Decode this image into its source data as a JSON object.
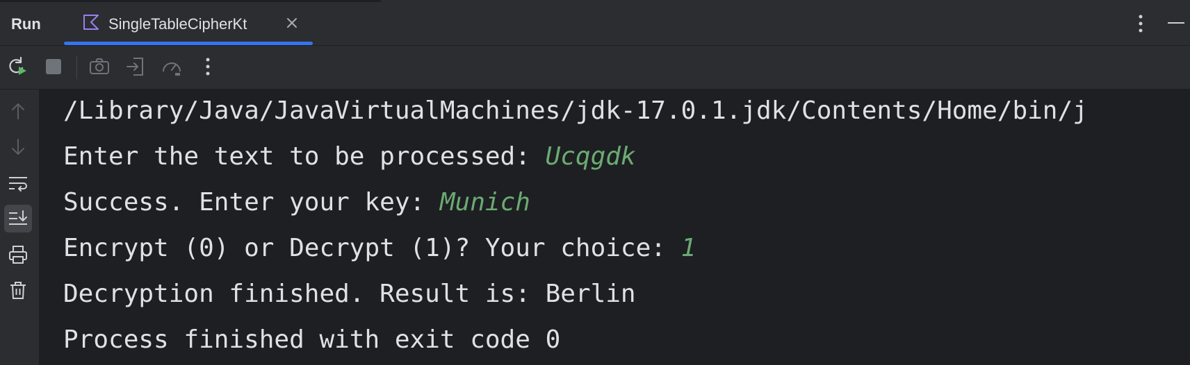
{
  "tabbar": {
    "title": "Run",
    "tab": {
      "label": "SingleTableCipherKt",
      "icon": "kotlin-icon"
    }
  },
  "toolbar": {
    "buttons": [
      "rerun-icon",
      "stop-icon",
      "camera-icon",
      "exit-icon",
      "gauge-icon",
      "more-icon"
    ]
  },
  "gutter": {
    "buttons": [
      "arrow-up-icon",
      "arrow-down-icon",
      "soft-wrap-icon",
      "scroll-to-end-icon",
      "print-icon",
      "trash-icon"
    ]
  },
  "console": {
    "lines": [
      {
        "text": "/Library/Java/JavaVirtualMachines/jdk-17.0.1.jdk/Contents/Home/bin/j",
        "input": ""
      },
      {
        "text": "Enter the text to be processed: ",
        "input": "Ucqgdk"
      },
      {
        "text": "Success. Enter your key: ",
        "input": "Munich"
      },
      {
        "text": "Encrypt (0) or Decrypt (1)? Your choice: ",
        "input": "1"
      },
      {
        "text": "Decryption finished. Result is: Berlin",
        "input": ""
      },
      {
        "text": "Process finished with exit code 0",
        "input": ""
      }
    ]
  },
  "colors": {
    "background": "#1e1f22",
    "panel": "#2b2d30",
    "text": "#dfe1e5",
    "user_input": "#6aab73",
    "accent": "#3574f0"
  }
}
